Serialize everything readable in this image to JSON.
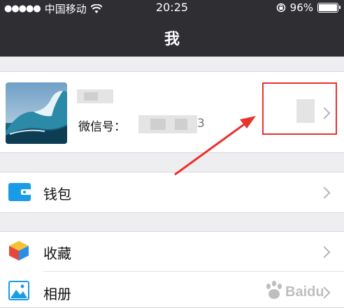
{
  "status_bar": {
    "signal_dots": "●●●●●",
    "carrier": "中国移动",
    "time": "20:25",
    "battery_percent": "96%",
    "battery_level": 0.96
  },
  "nav": {
    "title": "我"
  },
  "profile": {
    "wechat_id_label": "微信号：",
    "wechat_id_tail": "3"
  },
  "menu": {
    "wallet": "钱包",
    "favorites": "收藏",
    "album": "相册"
  },
  "watermark": {
    "text": "Baidu"
  },
  "colors": {
    "nav_bg": "#2e2e33",
    "page_bg": "#eeeef0",
    "annotation_red": "#e8322c"
  }
}
